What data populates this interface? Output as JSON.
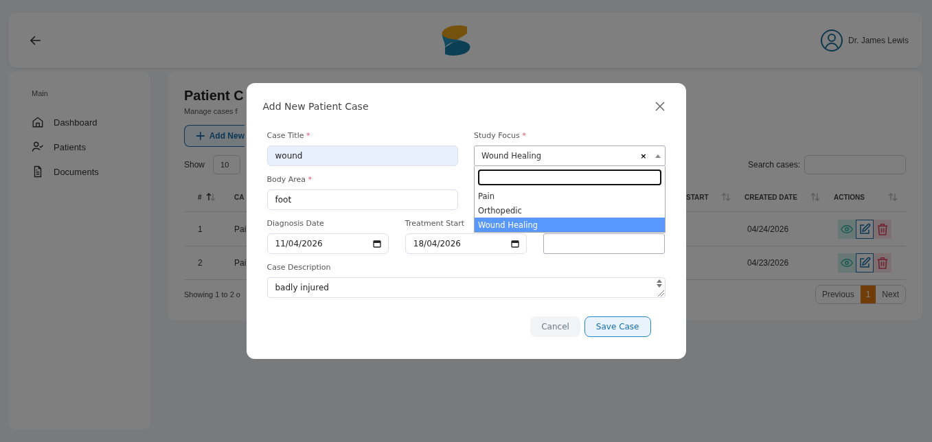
{
  "header": {
    "user_name": "Dr. James Lewis"
  },
  "sidebar": {
    "section": "Main",
    "items": [
      {
        "label": "Dashboard",
        "selected": false
      },
      {
        "label": "Patients",
        "selected": false
      },
      {
        "label": "Documents",
        "selected": false
      }
    ]
  },
  "page": {
    "title": "Patient C",
    "subtitle": "Manage cases f",
    "add_button": "Add New",
    "show_label": "Show",
    "show_value": "10",
    "search_label": "Search cases:"
  },
  "table": {
    "columns": [
      {
        "label": "#"
      },
      {
        "label": "CA"
      },
      {
        "label": "START"
      },
      {
        "label": "CREATED DATE"
      },
      {
        "label": "ACTIONS"
      }
    ],
    "rows": [
      {
        "number": "1",
        "case": "Pai",
        "created": "04/24/2026"
      },
      {
        "number": "2",
        "case": "Pai",
        "created": "04/23/2026"
      }
    ]
  },
  "footer": {
    "showing": "Showing 1 to 2 o",
    "pagination": [
      {
        "label": "Previous",
        "selected": false
      },
      {
        "label": "1",
        "selected": true
      },
      {
        "label": "Next",
        "selected": false
      }
    ]
  },
  "modal": {
    "title": "Add New Patient Case",
    "case_title": {
      "label": "Case Title",
      "required_mark": "*",
      "value": "wound",
      "autofilled": true
    },
    "study_focus": {
      "label": "Study Focus",
      "required_mark": "*",
      "value": "Wound Healing",
      "clear_symbol": "×",
      "expanded": true,
      "options": [
        {
          "label": "Pain",
          "selected": false
        },
        {
          "label": "Orthopedic",
          "selected": false
        },
        {
          "label": "Wound Healing",
          "selected": true
        }
      ]
    },
    "body_area": {
      "label": "Body Area",
      "required_mark": "*",
      "value": "foot"
    },
    "diagnosis_date": {
      "label": "Diagnosis Date",
      "value": "11/04/2026"
    },
    "treatment_start": {
      "label": "Treatment Start",
      "value": "18/04/2026"
    },
    "description": {
      "label": "Case Description",
      "value": "badly injured"
    },
    "buttons": [
      {
        "label": "Cancel",
        "kind": "secondary"
      },
      {
        "label": "Save Case",
        "kind": "primary"
      }
    ]
  }
}
